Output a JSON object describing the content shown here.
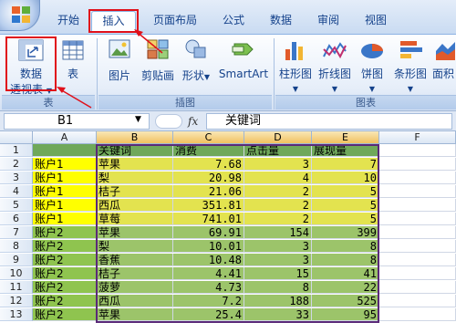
{
  "ribbon_tabs": [
    {
      "label": "开始"
    },
    {
      "label": "插入",
      "active": true
    },
    {
      "label": "页面布局"
    },
    {
      "label": "公式"
    },
    {
      "label": "数据"
    },
    {
      "label": "审阅"
    },
    {
      "label": "视图"
    }
  ],
  "ribbon": {
    "pivot_label_line1": "数据",
    "pivot_label_line2": "透视表",
    "table_label": "表",
    "picture_label": "图片",
    "clipart_label": "剪贴画",
    "shapes_label": "形状",
    "smartart_label": "SmartArt",
    "column_chart_label": "柱形图",
    "line_chart_label": "折线图",
    "pie_chart_label": "饼图",
    "bar_chart_label": "条形图",
    "area_chart_label": "面积",
    "groups": {
      "tables": "表",
      "illustrations": "插图",
      "charts": "图表"
    }
  },
  "formula_bar": {
    "name_box": "B1",
    "fx": "fx",
    "content": "关键词"
  },
  "grid": {
    "columns": [
      "A",
      "B",
      "C",
      "D",
      "E",
      "F"
    ],
    "rows": [
      {
        "n": "1",
        "a": "",
        "b": "关键词",
        "c": "消费",
        "d": "点击量",
        "e": "展现量"
      },
      {
        "n": "2",
        "a": "账户1",
        "b": "苹果",
        "c": "7.68",
        "d": "3",
        "e": "7"
      },
      {
        "n": "3",
        "a": "账户1",
        "b": "梨",
        "c": "20.98",
        "d": "4",
        "e": "10"
      },
      {
        "n": "4",
        "a": "账户1",
        "b": "桔子",
        "c": "21.06",
        "d": "2",
        "e": "5"
      },
      {
        "n": "5",
        "a": "账户1",
        "b": "西瓜",
        "c": "351.81",
        "d": "2",
        "e": "5"
      },
      {
        "n": "6",
        "a": "账户1",
        "b": "草莓",
        "c": "741.01",
        "d": "2",
        "e": "5"
      },
      {
        "n": "7",
        "a": "账户2",
        "b": "苹果",
        "c": "69.91",
        "d": "154",
        "e": "399"
      },
      {
        "n": "8",
        "a": "账户2",
        "b": "梨",
        "c": "10.01",
        "d": "3",
        "e": "8"
      },
      {
        "n": "9",
        "a": "账户2",
        "b": "香蕉",
        "c": "10.48",
        "d": "3",
        "e": "8"
      },
      {
        "n": "10",
        "a": "账户2",
        "b": "桔子",
        "c": "4.41",
        "d": "15",
        "e": "41"
      },
      {
        "n": "11",
        "a": "账户2",
        "b": "菠萝",
        "c": "4.73",
        "d": "8",
        "e": "22"
      },
      {
        "n": "12",
        "a": "账户2",
        "b": "西瓜",
        "c": "7.2",
        "d": "188",
        "e": "525"
      },
      {
        "n": "13",
        "a": "账户2",
        "b": "苹果",
        "c": "25.4",
        "d": "33",
        "e": "95"
      }
    ]
  },
  "colors": {
    "highlight_red": "#e0101a",
    "group1_yellow": "#ffff00",
    "group1_data": "#e3e34f",
    "group2_green": "#8fc44f",
    "group2_data": "#9cc46a",
    "header_green": "#6fa85a",
    "selection_border": "#5a2a78"
  }
}
